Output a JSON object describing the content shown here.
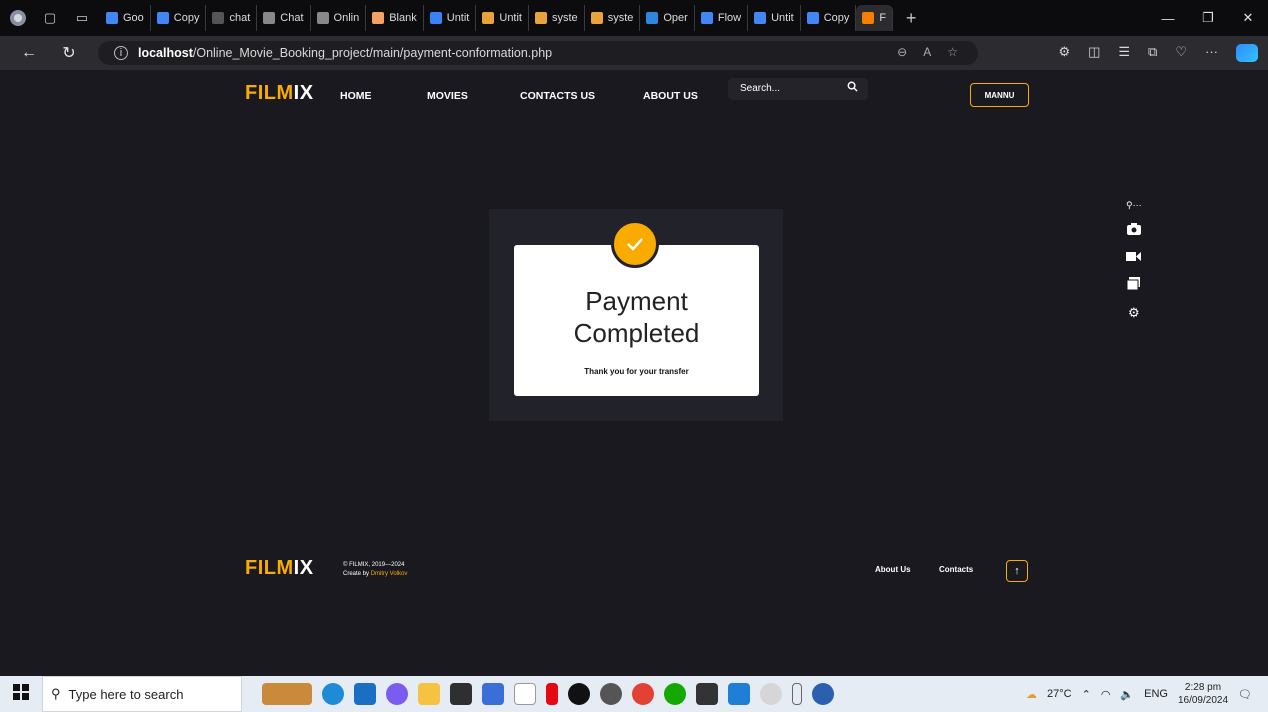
{
  "browser": {
    "tabs": [
      {
        "label": "Goo",
        "color": "#4285f4"
      },
      {
        "label": "Copy",
        "color": "#4285f4"
      },
      {
        "label": "chat",
        "color": "#555555"
      },
      {
        "label": "Chat",
        "color": "#888888"
      },
      {
        "label": "Onlin",
        "color": "#888888"
      },
      {
        "label": "Blank",
        "color": "#f4a261"
      },
      {
        "label": "Untit",
        "color": "#3b82f6"
      },
      {
        "label": "Untit",
        "color": "#e8a33d"
      },
      {
        "label": "syste",
        "color": "#e8a33d"
      },
      {
        "label": "syste",
        "color": "#e8a33d"
      },
      {
        "label": "Oper",
        "color": "#2e86de"
      },
      {
        "label": "Flow",
        "color": "#4285f4"
      },
      {
        "label": "Untit",
        "color": "#4285f4"
      },
      {
        "label": "Copy",
        "color": "#4285f4"
      },
      {
        "label": "F",
        "color": "#f77f00"
      }
    ],
    "url_host": "localhost",
    "url_path": "/Online_Movie_Booking_project/main/payment-conformation.php"
  },
  "site": {
    "logo_a": "FILM",
    "logo_b": "IX",
    "nav": [
      "HOME",
      "MOVIES",
      "CONTACTS US",
      "ABOUT US"
    ],
    "search_placeholder": "Search...",
    "user_button": "MANNU"
  },
  "card": {
    "title_line1": "Payment",
    "title_line2": "Completed",
    "subtitle": "Thank you for your transfer"
  },
  "footer": {
    "logo_a": "FILM",
    "logo_b": "IX",
    "copyright": "© FILMIX, 2019—2024",
    "created_by": "Create by ",
    "author": "Dmitry Volkov",
    "links": [
      "About Us",
      "Contacts"
    ],
    "up_arrow": "↑"
  },
  "taskbar": {
    "search_placeholder": "Type here to search",
    "weather": "27°C",
    "language": "ENG",
    "time": "2:28 pm",
    "date": "16/09/2024"
  },
  "colors": {
    "accent": "#f9ab00",
    "page_bg": "#1a191f"
  }
}
